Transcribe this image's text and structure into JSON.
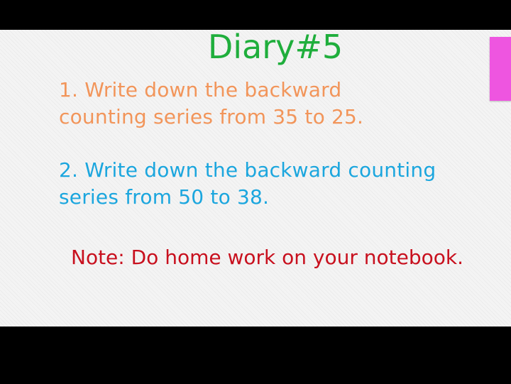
{
  "slide": {
    "title": "Diary#5",
    "item1": {
      "line1": "1. Write down the backward",
      "line2": "counting series from 35 to 25."
    },
    "item2": {
      "line1": "2. Write down the backward counting",
      "line2": "series from 50 to 38."
    },
    "note": "Note: Do home work on your notebook."
  },
  "colors": {
    "title": "#1fae3c",
    "item1": "#f2955a",
    "item2": "#1ba6de",
    "note": "#c8101e",
    "accent_tab": "#ee55e0",
    "background": "#f4f4f4",
    "letterbox": "#000000"
  }
}
